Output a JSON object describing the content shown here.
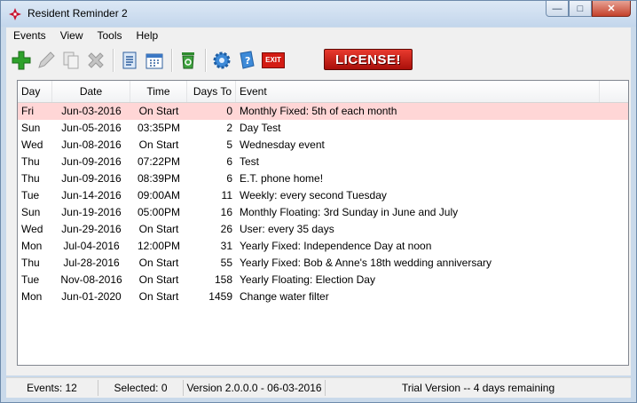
{
  "window": {
    "title": "Resident Reminder 2"
  },
  "menu": [
    "Events",
    "View",
    "Tools",
    "Help"
  ],
  "toolbar": {
    "license_label": "LICENSE!",
    "exit_label": "EXIT"
  },
  "columns": [
    "Day",
    "Date",
    "Time",
    "Days To",
    "Event"
  ],
  "rows": [
    {
      "day": "Fri",
      "date": "Jun-03-2016",
      "time": "On Start",
      "days": "0",
      "event": "Monthly Fixed: 5th of each month"
    },
    {
      "day": "Sun",
      "date": "Jun-05-2016",
      "time": "03:35PM",
      "days": "2",
      "event": "Day Test"
    },
    {
      "day": "Wed",
      "date": "Jun-08-2016",
      "time": "On Start",
      "days": "5",
      "event": "Wednesday event"
    },
    {
      "day": "Thu",
      "date": "Jun-09-2016",
      "time": "07:22PM",
      "days": "6",
      "event": "Test"
    },
    {
      "day": "Thu",
      "date": "Jun-09-2016",
      "time": "08:39PM",
      "days": "6",
      "event": "E.T. phone home!"
    },
    {
      "day": "Tue",
      "date": "Jun-14-2016",
      "time": "09:00AM",
      "days": "11",
      "event": "Weekly: every second Tuesday"
    },
    {
      "day": "Sun",
      "date": "Jun-19-2016",
      "time": "05:00PM",
      "days": "16",
      "event": "Monthly Floating: 3rd Sunday in June and July"
    },
    {
      "day": "Wed",
      "date": "Jun-29-2016",
      "time": "On Start",
      "days": "26",
      "event": "User: every 35 days"
    },
    {
      "day": "Mon",
      "date": "Jul-04-2016",
      "time": "12:00PM",
      "days": "31",
      "event": "Yearly Fixed: Independence Day at noon"
    },
    {
      "day": "Thu",
      "date": "Jul-28-2016",
      "time": "On Start",
      "days": "55",
      "event": "Yearly Fixed: Bob & Anne's 18th wedding anniversary"
    },
    {
      "day": "Tue",
      "date": "Nov-08-2016",
      "time": "On Start",
      "days": "158",
      "event": "Yearly Floating: Election Day"
    },
    {
      "day": "Mon",
      "date": "Jun-01-2020",
      "time": "On Start",
      "days": "1459",
      "event": "Change water filter"
    }
  ],
  "status": {
    "events": "Events: 12",
    "selected": "Selected: 0",
    "version": "Version 2.0.0.0 - 06-03-2016",
    "trial": "Trial Version -- 4 days remaining"
  }
}
